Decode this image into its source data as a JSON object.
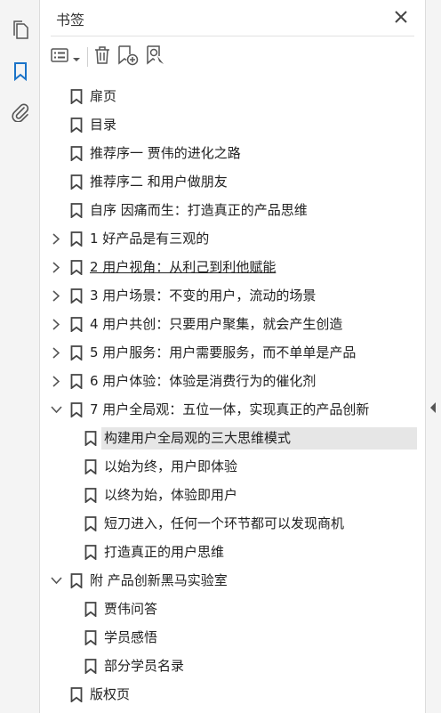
{
  "panel": {
    "title": "书签",
    "close_icon": "close-icon"
  },
  "sidebar": {
    "icons": [
      "pages-icon",
      "bookmark-icon",
      "attachment-icon"
    ],
    "active": "bookmark-icon"
  },
  "toolbar": {
    "icons": [
      "options-icon",
      "chevron-down-icon",
      "delete-icon",
      "new-bookmark-icon",
      "find-bookmark-icon"
    ]
  },
  "bookmarks": [
    {
      "label": "扉页",
      "level": 0,
      "chevron": "none"
    },
    {
      "label": "目录",
      "level": 0,
      "chevron": "none"
    },
    {
      "label": "推荐序一 贾伟的进化之路",
      "level": 0,
      "chevron": "none"
    },
    {
      "label": "推荐序二 和用户做朋友",
      "level": 0,
      "chevron": "none"
    },
    {
      "label": "自序 因痛而生：打造真正的产品思维",
      "level": 0,
      "chevron": "none"
    },
    {
      "label": "1 好产品是有三观的",
      "level": 0,
      "chevron": "collapsed"
    },
    {
      "label": "2 用户视角：从利己到利他赋能",
      "level": 0,
      "chevron": "collapsed",
      "underline": true
    },
    {
      "label": "3 用户场景：不变的用户，流动的场景",
      "level": 0,
      "chevron": "collapsed"
    },
    {
      "label": "4 用户共创：只要用户聚集，就会产生创造",
      "level": 0,
      "chevron": "collapsed"
    },
    {
      "label": "5 用户服务：用户需要服务，而不单单是产品",
      "level": 0,
      "chevron": "collapsed"
    },
    {
      "label": "6 用户体验：体验是消费行为的催化剂",
      "level": 0,
      "chevron": "collapsed"
    },
    {
      "label": "7 用户全局观：五位一体，实现真正的产品创新",
      "level": 0,
      "chevron": "expanded"
    },
    {
      "label": "构建用户全局观的三大思维模式",
      "level": 1,
      "chevron": "none",
      "selected": true
    },
    {
      "label": "以始为终，用户即体验",
      "level": 1,
      "chevron": "none"
    },
    {
      "label": "以终为始，体验即用户",
      "level": 1,
      "chevron": "none"
    },
    {
      "label": "短刀进入，任何一个环节都可以发现商机",
      "level": 1,
      "chevron": "none"
    },
    {
      "label": "打造真正的用户思维",
      "level": 1,
      "chevron": "none"
    },
    {
      "label": "附 产品创新黑马实验室",
      "level": 0,
      "chevron": "expanded"
    },
    {
      "label": "贾伟问答",
      "level": 1,
      "chevron": "none"
    },
    {
      "label": "学员感悟",
      "level": 1,
      "chevron": "none"
    },
    {
      "label": "部分学员名录",
      "level": 1,
      "chevron": "none"
    },
    {
      "label": "版权页",
      "level": 0,
      "chevron": "none"
    }
  ],
  "colors": {
    "accent": "#1a73c8",
    "icon": "#555555",
    "selected_bg": "#e6e6e6"
  }
}
